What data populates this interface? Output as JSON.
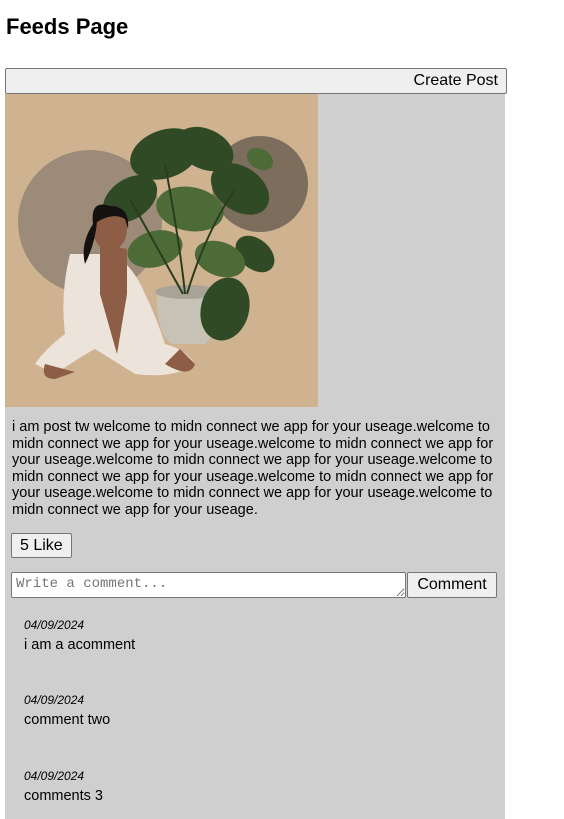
{
  "page": {
    "title": "Feeds Page",
    "create_post_label": "Create Post"
  },
  "post": {
    "image": {
      "icon": "illustration-woman-with-monstera-plant",
      "colors": {
        "background": "#cfb28f",
        "circle_left": "#9b8b78",
        "circle_right": "#7d6d5c",
        "leaf_dark": "#2f4a24",
        "leaf_light": "#4d6b36",
        "pot": "#c6c2b6",
        "skin": "#8e5d45",
        "hair": "#141110",
        "robe": "#ece3da"
      }
    },
    "text": "i am post tw welcome to midn connect we app for your useage.welcome to midn connect we app for your useage.welcome to midn connect we app for your useage.welcome to midn connect we app for your useage.welcome to midn connect we app for your useage.welcome to midn connect we app for your useage.welcome to midn connect we app for your useage.welcome to midn connect we app for your useage.",
    "like_label": "5 Like",
    "comment_placeholder": "Write a comment...",
    "comment_button_label": "Comment",
    "comments": [
      {
        "date": "04/09/2024",
        "text": "i am a acomment"
      },
      {
        "date": "04/09/2024",
        "text": "comment two"
      },
      {
        "date": "04/09/2024",
        "text": "comments 3"
      }
    ]
  },
  "colors": {
    "card_background": "#cfcfcf",
    "button_background": "#efefef",
    "button_border": "#767676"
  }
}
